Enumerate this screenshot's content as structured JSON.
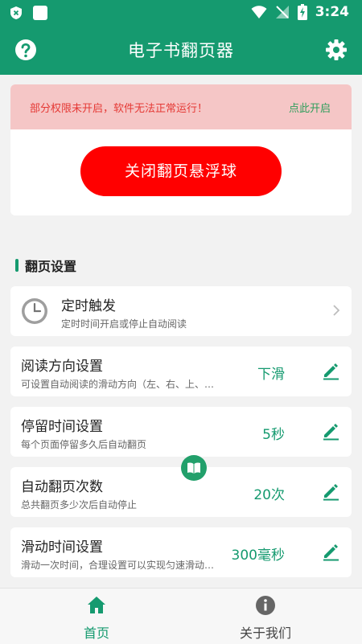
{
  "status_bar": {
    "time": "3:24",
    "icons": [
      "shield-x-icon",
      "notification-square-icon",
      "wifi-icon",
      "no-signal-icon",
      "battery-charging-icon"
    ]
  },
  "app_bar": {
    "title": "电子书翻页器",
    "left_icon": "help-icon",
    "right_icon": "gear-icon"
  },
  "permission": {
    "message": "部分权限未开启，软件无法正常运行！",
    "action": "点此开启"
  },
  "float_button": {
    "label": "关闭翻页悬浮球"
  },
  "section": {
    "title": "翻页设置"
  },
  "settings": [
    {
      "id": "timer",
      "title": "定时触发",
      "subtitle": "定时时间开启或停止自动阅读",
      "value": ""
    },
    {
      "id": "direction",
      "title": "阅读方向设置",
      "subtitle": "可设置自动阅读的滑动方向（左、右、上、…",
      "value": "下滑"
    },
    {
      "id": "stay",
      "title": "停留时间设置",
      "subtitle": "每个页面停留多久后自动翻页",
      "value": "5秒"
    },
    {
      "id": "count",
      "title": "自动翻页次数",
      "subtitle": "总共翻页多少次后自动停止",
      "value": "20次"
    },
    {
      "id": "slide",
      "title": "滑动时间设置",
      "subtitle": "滑动一次时间，合理设置可以实现匀速滑动…",
      "value": "300毫秒"
    }
  ],
  "bottom_nav": {
    "home": "首页",
    "about": "关于我们"
  },
  "colors": {
    "primary": "#159a6f",
    "danger": "#ff0000",
    "banner": "#f5c6c6",
    "banner_text": "#e53935"
  }
}
